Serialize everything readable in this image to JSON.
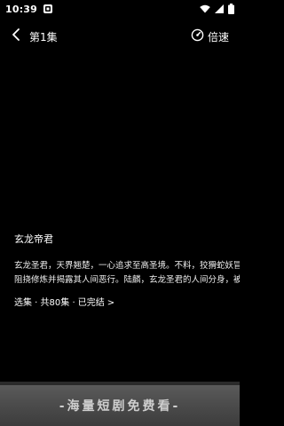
{
  "status_bar": {
    "time": "10:39",
    "icons": [
      "app-notification-icon",
      "wifi-icon",
      "signal-icon",
      "battery-icon"
    ]
  },
  "header": {
    "back_icon": "chevron-left-icon",
    "episode_title": "第1集",
    "speed_icon": "speed-gauge-icon",
    "speed_label": "倍速"
  },
  "info": {
    "title": "玄龙帝君",
    "synopsis_line1": "玄龙圣君，天界翘楚，一心追求至高圣境。不料，狡猾蛇妖冒充",
    "synopsis_line2": "阻挠修炼并揭露其人间恶行。陆麟，玄龙圣君的人间分身，被数",
    "episodes_text": "选集 · 共80集 · 已完结",
    "episodes_arrow": ">"
  },
  "banner": {
    "text": "-海量短剧免费看-"
  }
}
